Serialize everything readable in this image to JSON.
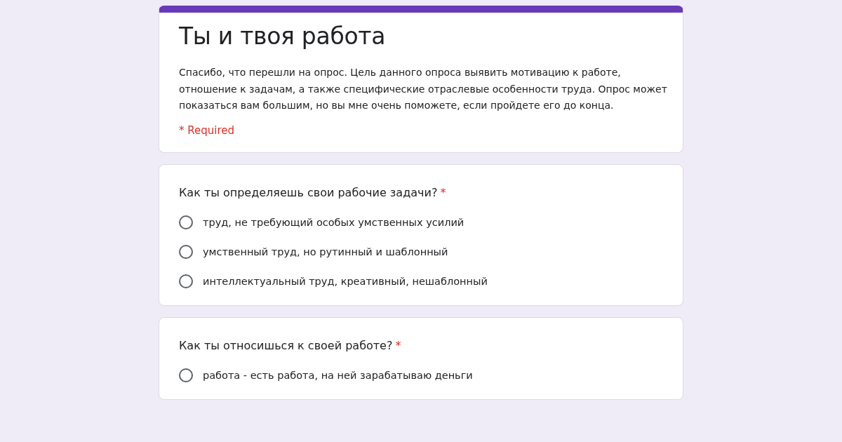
{
  "form": {
    "title": "Ты и твоя работа",
    "description": "Спасибо, что перешли на опрос. Цель данного опроса выявить мотивацию к работе, отношение к задачам, а также специфические отраслевые особенности труда. Опрос может показаться вам большим, но вы мне очень поможете, если пройдете его до конца.",
    "required_note": "* Required"
  },
  "questions": [
    {
      "title": "Как ты определяешь свои рабочие задачи?",
      "required_mark": "*",
      "options": [
        {
          "label": "труд, не требующий особых умственных усилий",
          "selected": false
        },
        {
          "label": "умственный труд, но рутинный и шаблонный",
          "selected": false
        },
        {
          "label": "интеллектуальный труд, креативный, нешаблонный",
          "selected": false
        }
      ]
    },
    {
      "title": "Как ты относишься к своей работе?",
      "required_mark": "*",
      "options": [
        {
          "label": "работа - есть работа, на ней зарабатываю деньги",
          "selected": false
        }
      ]
    }
  ]
}
